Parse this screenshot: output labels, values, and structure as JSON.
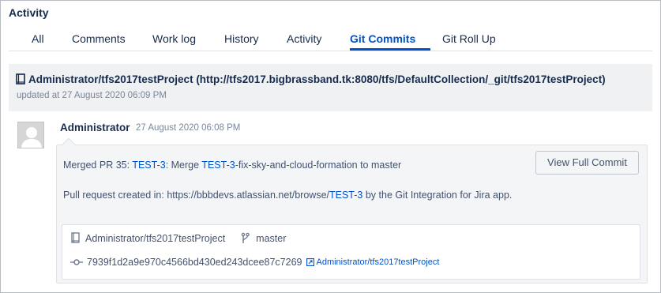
{
  "section": {
    "title": "Activity"
  },
  "tabs": [
    {
      "label": "All",
      "active": false
    },
    {
      "label": "Comments",
      "active": false
    },
    {
      "label": "Work log",
      "active": false
    },
    {
      "label": "History",
      "active": false
    },
    {
      "label": "Activity",
      "active": false
    },
    {
      "label": "Git Commits",
      "active": true
    },
    {
      "label": "Git Roll Up",
      "active": false
    }
  ],
  "repository": {
    "title": "Administrator/tfs2017testProject (http://tfs2017.bigbrassband.tk:8080/tfs/DefaultCollection/_git/tfs2017testProject)",
    "updated": "updated at 27 August 2020 06:09 PM"
  },
  "commit": {
    "author": "Administrator",
    "date": "27 August 2020 06:08 PM",
    "message_line1": {
      "prefix": "Merged PR 35: ",
      "issue1": "TEST-3",
      "middle": ": Merge ",
      "issue2": "TEST-3",
      "suffix": "-fix-sky-and-cloud-formation to master"
    },
    "message_line2": {
      "prefix": "Pull request created in: https://bbbdevs.atlassian.net/browse/",
      "issue": "TEST-3",
      "suffix": " by the Git Integration for Jira app."
    },
    "view_button": "View Full Commit",
    "repo_name": "Administrator/tfs2017testProject",
    "branch": "master",
    "hash": "7939f1d2a9e970c4566bd430ed243dcee87c7269",
    "repo_link": "Administrator/tfs2017testProject"
  },
  "colors": {
    "accent": "#0052cc",
    "text": "#172b4d",
    "muted": "#7a869a",
    "panel": "#f4f5f7"
  },
  "icons": {
    "repo": "book-icon",
    "branch": "git-branch-icon",
    "commit": "git-commit-icon",
    "external": "external-link-icon"
  }
}
